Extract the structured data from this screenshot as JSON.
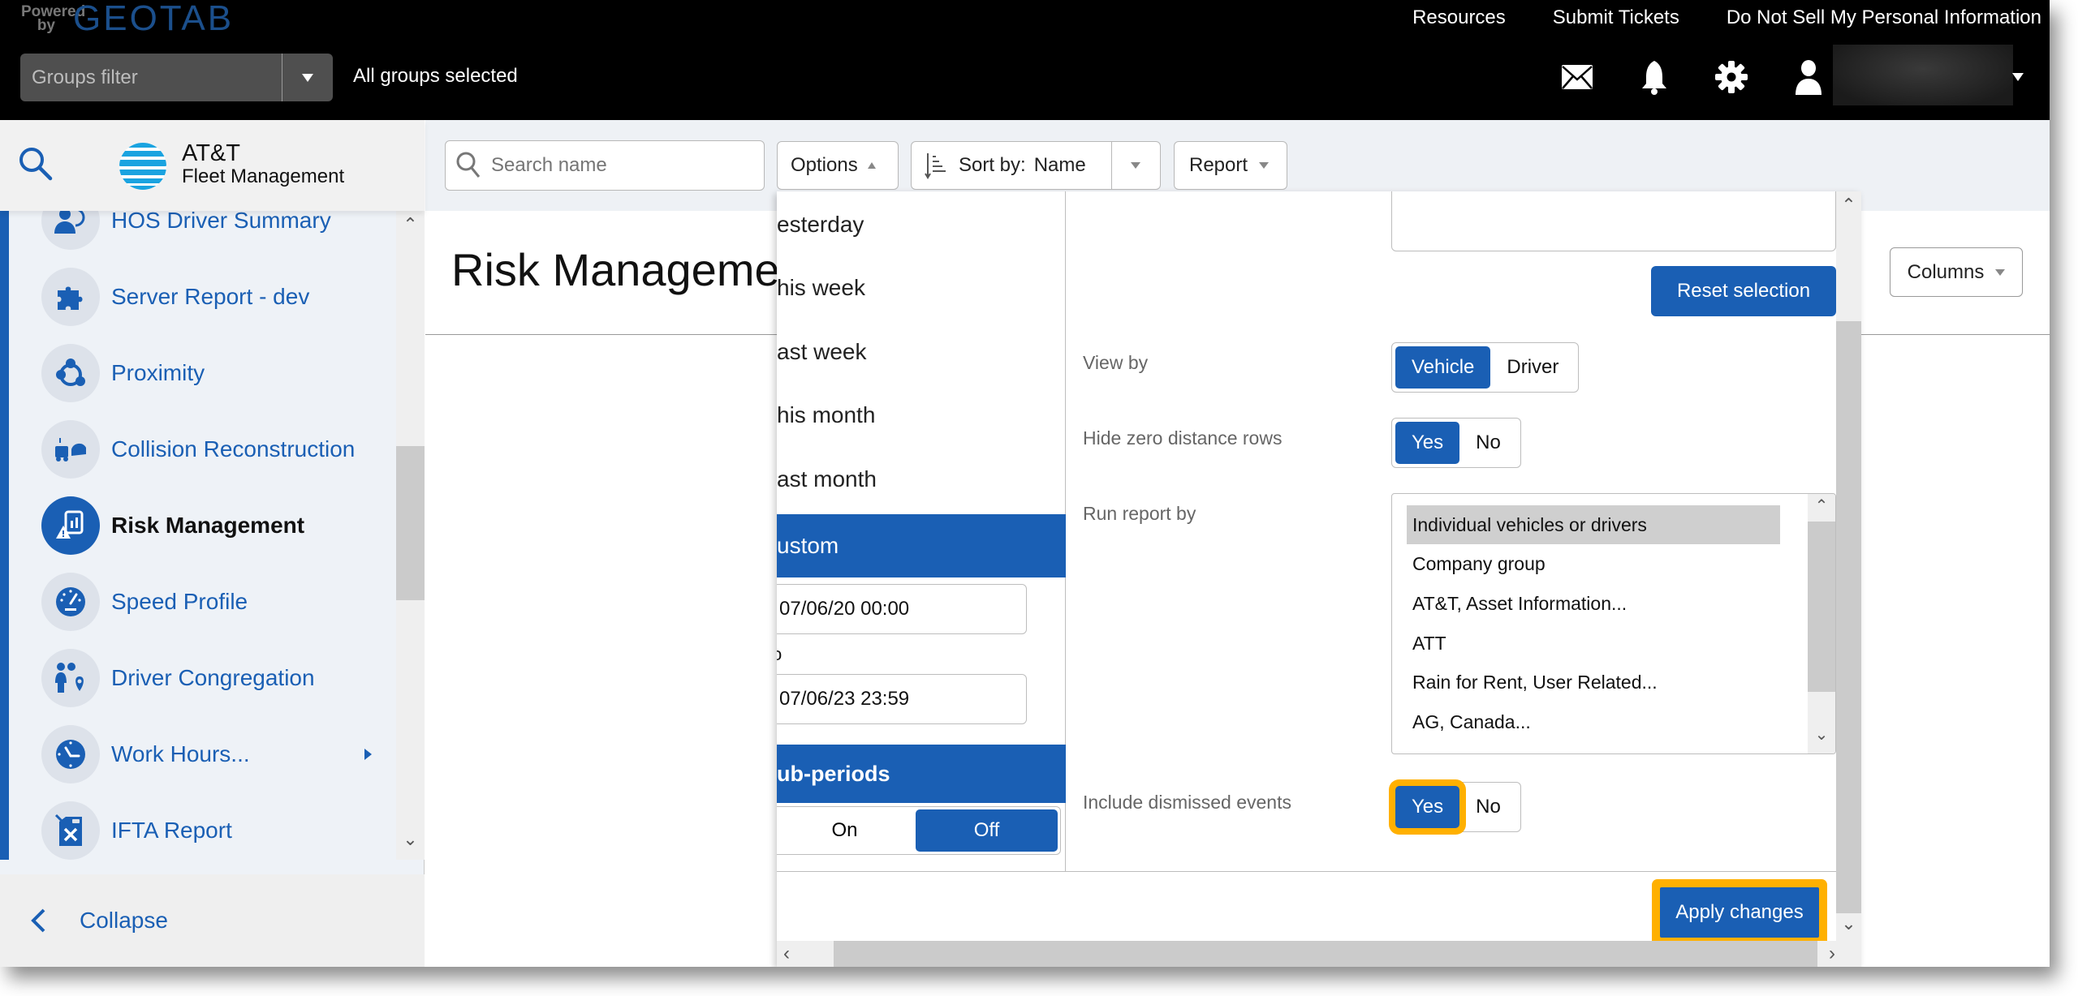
{
  "header": {
    "powered_by": "Powered by",
    "brand": "GEOTAB",
    "links": [
      "Resources",
      "Submit Tickets",
      "Do Not Sell My Personal Information"
    ],
    "groups_filter_placeholder": "Groups filter",
    "groups_status": "All groups selected",
    "icons": [
      "mail-icon",
      "bell-icon",
      "gear-icon",
      "user-icon"
    ]
  },
  "sidebar": {
    "logo_line1": "AT&T",
    "logo_line2": "Fleet Management",
    "items": [
      {
        "label": "HOS Driver Summary",
        "icon": "hos-driver-icon",
        "active": false
      },
      {
        "label": "Server Report - dev",
        "icon": "puzzle-icon",
        "active": false
      },
      {
        "label": "Proximity",
        "icon": "proximity-icon",
        "active": false
      },
      {
        "label": "Collision Reconstruction",
        "icon": "collision-icon",
        "active": false
      },
      {
        "label": "Risk Management",
        "icon": "risk-report-icon",
        "active": true
      },
      {
        "label": "Speed Profile",
        "icon": "speedometer-icon",
        "active": false
      },
      {
        "label": "Driver Congregation",
        "icon": "driver-congregation-icon",
        "active": false
      },
      {
        "label": "Work Hours...",
        "icon": "clock-icon",
        "active": false,
        "has_submenu": true
      },
      {
        "label": "IFTA Report",
        "icon": "fuel-can-icon",
        "active": false
      }
    ],
    "collapse_label": "Collapse"
  },
  "toolbar": {
    "search_placeholder": "Search name",
    "options_label": "Options",
    "sort_prefix": "Sort by:",
    "sort_value": "Name",
    "report_label": "Report",
    "columns_label": "Columns"
  },
  "page": {
    "title": "Risk Management"
  },
  "options_popup": {
    "date_ranges": [
      {
        "label": "esterday",
        "selected": false
      },
      {
        "label": "his week",
        "selected": false
      },
      {
        "label": "ast week",
        "selected": false
      },
      {
        "label": "his month",
        "selected": false
      },
      {
        "label": "ast month",
        "selected": false
      },
      {
        "label": "ustom",
        "selected": true
      }
    ],
    "from_value": "07/06/20 00:00",
    "to_label": "o",
    "to_value": "07/06/23 23:59",
    "subperiods_heading": "ub-periods",
    "subperiods_options": [
      "On",
      "Off"
    ],
    "subperiods_selected": "Off",
    "reset_selection_label": "Reset selection",
    "view_by": {
      "label": "View by",
      "options": [
        "Vehicle",
        "Driver"
      ],
      "selected": "Vehicle"
    },
    "hide_zero_distance": {
      "label": "Hide zero distance rows",
      "options": [
        "Yes",
        "No"
      ],
      "selected": "Yes"
    },
    "run_report_by": {
      "label": "Run report by",
      "options": [
        "Individual vehicles or drivers",
        "Company group",
        "AT&T, Asset Information...",
        "ATT",
        "Rain for Rent, User Related...",
        "AG, Canada..."
      ],
      "selected": "Individual vehicles or drivers"
    },
    "include_dismissed": {
      "label": "Include dismissed events",
      "options": [
        "Yes",
        "No"
      ],
      "selected": "Yes"
    },
    "apply_label": "Apply changes"
  },
  "colors": {
    "accent": "#1a5fb4",
    "highlight": "#ffb000",
    "header_bg": "#000000"
  }
}
